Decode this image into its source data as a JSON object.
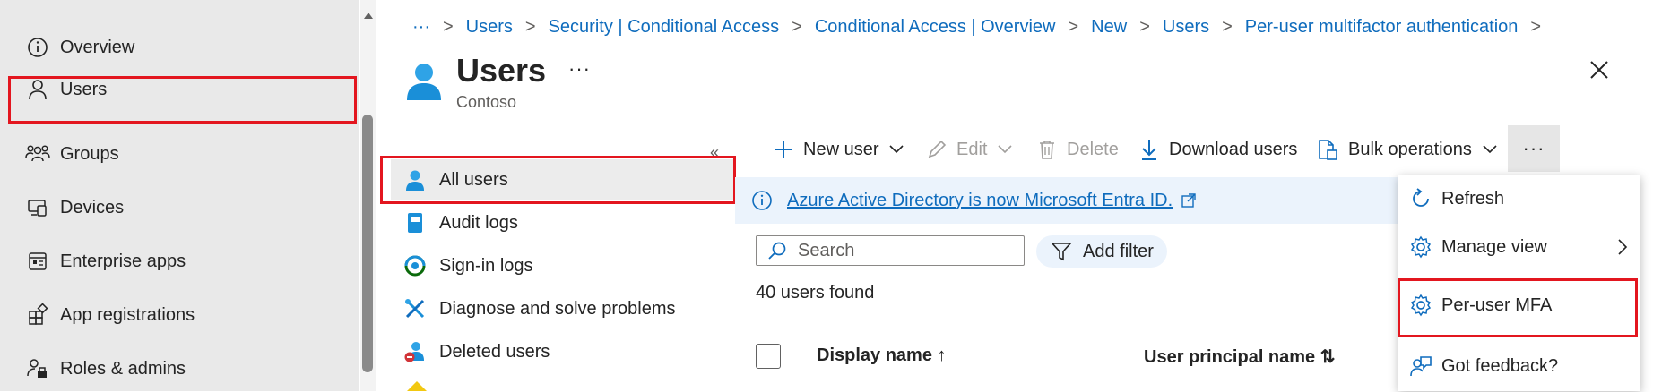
{
  "left_nav": {
    "items": [
      {
        "label": "Overview",
        "icon": "info-icon"
      },
      {
        "label": "Users",
        "icon": "person-icon"
      },
      {
        "label": "Groups",
        "icon": "people-icon"
      },
      {
        "label": "Devices",
        "icon": "devices-icon"
      },
      {
        "label": "Enterprise apps",
        "icon": "apps-icon"
      },
      {
        "label": "App registrations",
        "icon": "app-registrations-icon"
      },
      {
        "label": "Roles & admins",
        "icon": "roles-icon"
      }
    ],
    "selected": "Users"
  },
  "breadcrumb": {
    "ellipsis": "···",
    "items": [
      "Users",
      "Security | Conditional Access",
      "Conditional Access | Overview",
      "New",
      "Users",
      "Per-user multifactor authentication"
    ],
    "separator": ">"
  },
  "header": {
    "title": "Users",
    "subtitle": "Contoso",
    "more": "···"
  },
  "sub_nav": {
    "collapse": "«",
    "items": [
      {
        "label": "All users",
        "icon": "user-icon"
      },
      {
        "label": "Audit logs",
        "icon": "audit-logs-icon"
      },
      {
        "label": "Sign-in logs",
        "icon": "sign-in-logs-icon"
      },
      {
        "label": "Diagnose and solve problems",
        "icon": "diagnose-icon"
      },
      {
        "label": "Deleted users",
        "icon": "deleted-user-icon"
      }
    ],
    "selected": "All users"
  },
  "toolbar": {
    "new_user": "New user",
    "edit": "Edit",
    "delete": "Delete",
    "download_users": "Download users",
    "bulk_operations": "Bulk operations",
    "more": "···"
  },
  "banner": {
    "text": "Azure Active Directory is now Microsoft Entra ID."
  },
  "search": {
    "placeholder": "Search"
  },
  "filter": {
    "label": "Add filter"
  },
  "results": {
    "count_text": "40 users found"
  },
  "table": {
    "columns": [
      "Display name ↑",
      "User principal name ⇅"
    ]
  },
  "more_menu": {
    "items": [
      {
        "label": "Refresh",
        "icon": "refresh-icon"
      },
      {
        "label": "Manage view",
        "icon": "gear-icon",
        "has_submenu": true
      },
      {
        "label": "Per-user MFA",
        "icon": "gear-icon"
      },
      {
        "label": "Got feedback?",
        "icon": "feedback-icon"
      }
    ]
  },
  "colors": {
    "accent": "#0f6cbd",
    "highlight": "#e3161f",
    "nav_bg": "#e9e9e9",
    "banner_bg": "#ebf3fc"
  }
}
